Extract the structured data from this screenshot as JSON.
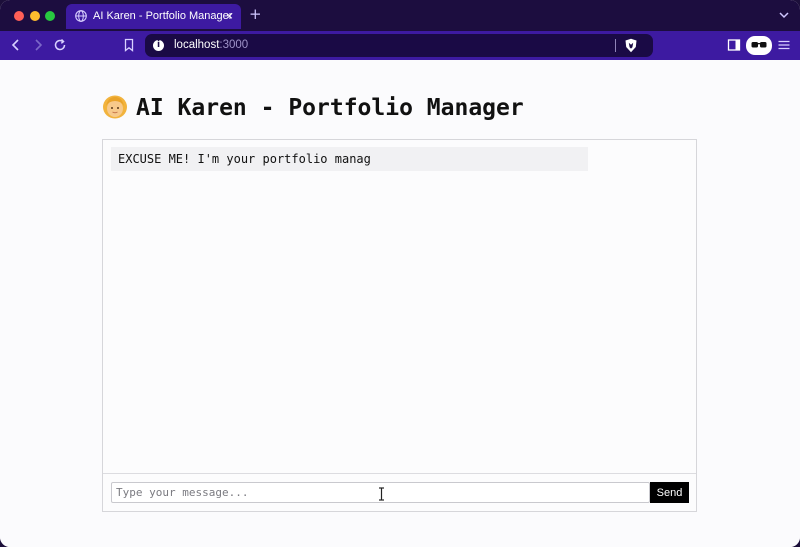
{
  "browser": {
    "tab_title": "AI Karen - Portfolio Manager",
    "tab_close": "×",
    "new_tab": "+",
    "url_host": "localhost",
    "url_port": ":3000",
    "colors": {
      "tab_strip": "#1c0d3f",
      "toolbar": "#3d1aa1",
      "url_bar": "#1a0a45"
    },
    "icons": [
      "globe-icon",
      "back-icon",
      "forward-icon",
      "reload-icon",
      "bookmark-icon",
      "site-info-icon",
      "brave-shield-icon",
      "sidebar-icon",
      "glasses-icon",
      "menu-icon",
      "tab-search-chevron-icon"
    ]
  },
  "app": {
    "title": "AI Karen - Portfolio Manager",
    "title_emoji": "woman-emoji",
    "messages": [
      {
        "role": "assistant",
        "text": "EXCUSE ME! I'm your portfolio manag"
      }
    ],
    "input": {
      "placeholder": "Type your message...",
      "value": ""
    },
    "send_label": "Send"
  }
}
